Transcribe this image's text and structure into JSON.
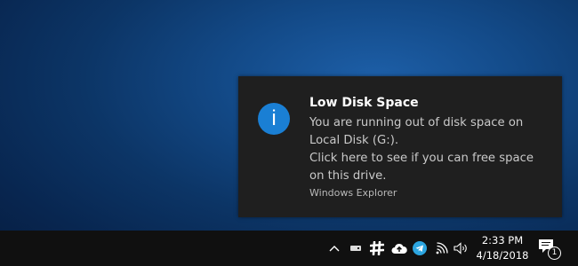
{
  "notification": {
    "icon": "info-icon",
    "icon_glyph": "i",
    "title": "Low Disk Space",
    "body_lines": [
      "You are running out of disk space on",
      "Local Disk (G:).",
      "Click here to see if you can free space",
      "on this drive."
    ],
    "source": "Windows Explorer",
    "accent_color": "#1a7fd4"
  },
  "taskbar": {
    "tray_icons": [
      "chevron-up-icon",
      "drive-icon",
      "slack-icon",
      "cloud-upload-icon",
      "telegram-icon",
      "wifi-icon",
      "volume-icon"
    ],
    "clock": {
      "time": "2:33 PM",
      "date": "4/18/2018"
    },
    "action_center": {
      "icon": "notifications-icon",
      "count": "1"
    }
  }
}
